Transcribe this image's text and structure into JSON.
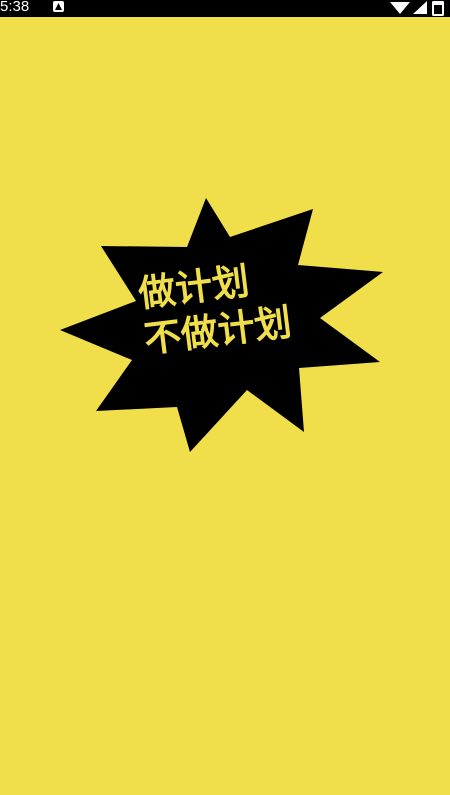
{
  "status_bar": {
    "time": "5:38",
    "icons": [
      "notification-icon",
      "wifi-icon",
      "signal-icon",
      "battery-icon"
    ]
  },
  "splash": {
    "line1": "做计划",
    "line2": "不做计划"
  },
  "colors": {
    "background": "#f0df4a",
    "burst": "#000000",
    "text": "#f0df4a"
  }
}
